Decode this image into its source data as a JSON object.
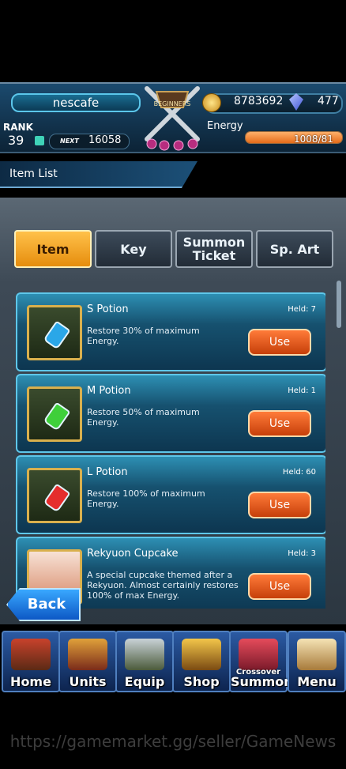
{
  "player": {
    "name": "nescafe",
    "gold": "8783692",
    "gems": "477",
    "rank_label": "RANK",
    "rank": "39",
    "next_label": "NEXT",
    "next_exp": "16058",
    "energy_label": "Energy",
    "energy": "1008/81",
    "emblem_text": "BEGINNERS"
  },
  "title": "Item List",
  "tabs": [
    {
      "label": "Item",
      "active": true
    },
    {
      "label": "Key",
      "active": false
    },
    {
      "label": "Summon Ticket",
      "active": false
    },
    {
      "label": "Sp. Art",
      "active": false
    }
  ],
  "items": [
    {
      "name": "S Potion",
      "held": "Held: 7",
      "desc": "Restore 30% of maximum Energy.",
      "use": "Use",
      "color": "#2aa7e8"
    },
    {
      "name": "M Potion",
      "held": "Held: 1",
      "desc": "Restore 50% of maximum Energy.",
      "use": "Use",
      "color": "#3fcf3a"
    },
    {
      "name": "L Potion",
      "held": "Held: 60",
      "desc": "Restore 100% of maximum Energy.",
      "use": "Use",
      "color": "#e52d2d"
    },
    {
      "name": "Rekyuon Cupcake",
      "held": "Held: 3",
      "desc": "A special cupcake themed after a Rekyuon. Almost certainly restores 100% of max Energy.",
      "use": "Use",
      "color": "#f2d2c0"
    }
  ],
  "back_label": "Back",
  "nav": [
    {
      "label": "Home",
      "small": ""
    },
    {
      "label": "Units",
      "small": ""
    },
    {
      "label": "Equip",
      "small": ""
    },
    {
      "label": "Shop",
      "small": ""
    },
    {
      "label": "Summon",
      "small": "Crossover"
    },
    {
      "label": "Menu",
      "small": ""
    }
  ],
  "watermark": "https://gamemarket.gg/seller/GameNews"
}
